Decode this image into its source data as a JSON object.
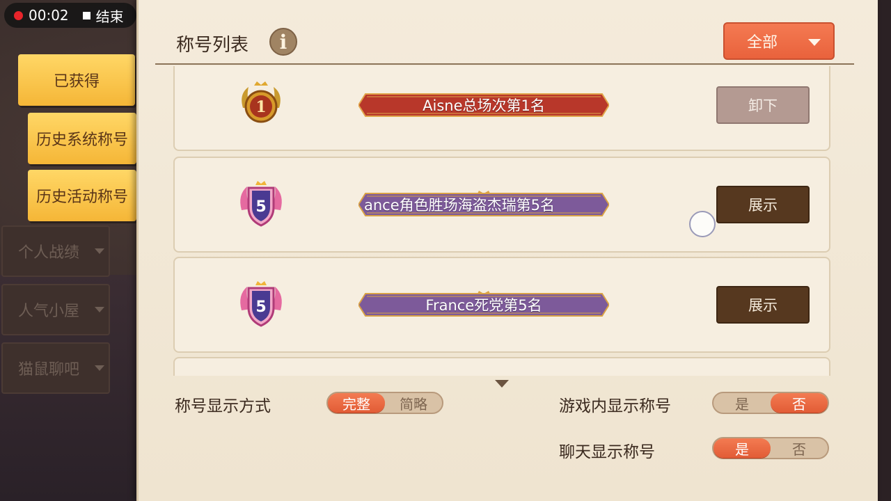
{
  "recording": {
    "time": "00:02",
    "stop_label": "结束"
  },
  "sidebar": {
    "tabs": [
      {
        "label": "已获得"
      },
      {
        "label": "历史系统称号"
      },
      {
        "label": "历史活动称号"
      },
      {
        "label": "个人战绩"
      },
      {
        "label": "人气小屋"
      },
      {
        "label": "猫鼠聊吧"
      }
    ]
  },
  "header": {
    "title": "称号列表",
    "info_icon_glyph": "i",
    "filter_label": "全部"
  },
  "titles": [
    {
      "badge_number": "1",
      "name": "Aisne总场次第1名",
      "action": "卸下",
      "ribbon_color": "#b8372a"
    },
    {
      "badge_number": "5",
      "name": "ance角色胜场海盗杰瑞第5名",
      "action": "展示",
      "ribbon_color": "#7d5a9a"
    },
    {
      "badge_number": "5",
      "name": "France死党第5名",
      "action": "展示",
      "ribbon_color": "#7d5a9a"
    }
  ],
  "settings": {
    "display_mode_label": "称号显示方式",
    "display_mode_options": [
      "完整",
      "简略"
    ],
    "display_mode_selected": "完整",
    "ingame_label": "游戏内显示称号",
    "ingame_options": [
      "是",
      "否"
    ],
    "ingame_selected": "否",
    "chat_label": "聊天显示称号",
    "chat_options": [
      "是",
      "否"
    ],
    "chat_selected": "是"
  },
  "colors": {
    "accent": "#ef6d45",
    "button_dark": "#56381f",
    "parchment": "#f4ebdb"
  }
}
